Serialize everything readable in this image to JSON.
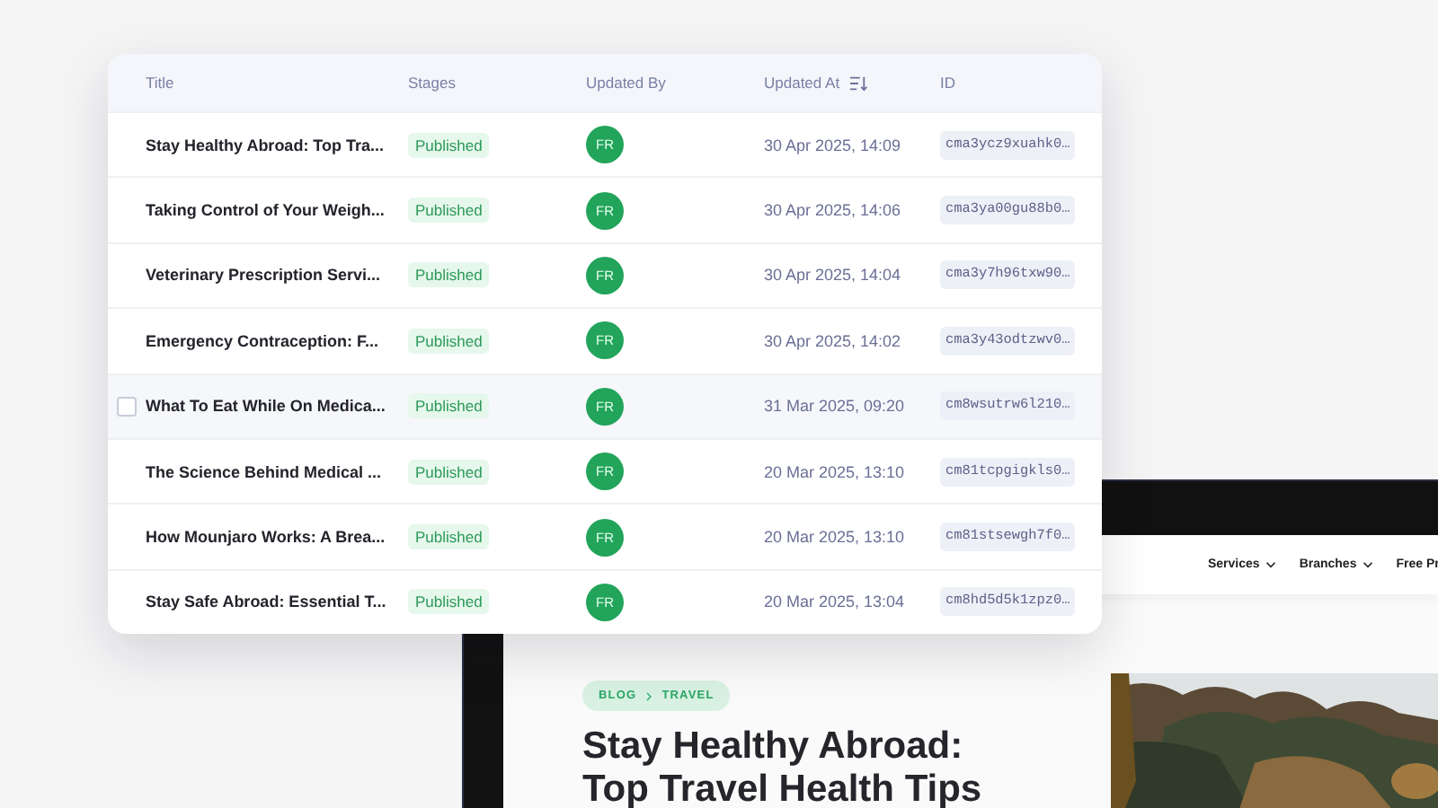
{
  "table": {
    "columns": [
      {
        "label": "Title",
        "sorted": false
      },
      {
        "label": "Stages",
        "sorted": false
      },
      {
        "label": "Updated By",
        "sorted": false
      },
      {
        "label": "Updated At",
        "sorted": true
      },
      {
        "label": "ID",
        "sorted": false
      }
    ],
    "rows": [
      {
        "title": "Stay Healthy Abroad: Top Tra...",
        "stage": "Published",
        "user": "FR",
        "updated": "30 Apr 2025, 14:09",
        "id": "cma3ycz9xuahk0…",
        "highlighted": false
      },
      {
        "title": "Taking Control of Your Weigh...",
        "stage": "Published",
        "user": "FR",
        "updated": "30 Apr 2025, 14:06",
        "id": "cma3ya00gu88b0…",
        "highlighted": false
      },
      {
        "title": "Veterinary Prescription Servi...",
        "stage": "Published",
        "user": "FR",
        "updated": "30 Apr 2025, 14:04",
        "id": "cma3y7h96txw90…",
        "highlighted": false
      },
      {
        "title": "Emergency Contraception: F...",
        "stage": "Published",
        "user": "FR",
        "updated": "30 Apr 2025, 14:02",
        "id": "cma3y43odtzwv0…",
        "highlighted": false
      },
      {
        "title": "What To Eat While On Medica...",
        "stage": "Published",
        "user": "FR",
        "updated": "31 Mar 2025, 09:20",
        "id": "cm8wsutrw6l210…",
        "highlighted": true
      },
      {
        "title": "The Science Behind Medical ...",
        "stage": "Published",
        "user": "FR",
        "updated": "20 Mar 2025, 13:10",
        "id": "cm81tcpgigkls0…",
        "highlighted": false
      },
      {
        "title": "How Mounjaro Works: A Brea...",
        "stage": "Published",
        "user": "FR",
        "updated": "20 Mar 2025, 13:10",
        "id": "cm81stsewgh7f0…",
        "highlighted": false
      },
      {
        "title": "Stay Safe Abroad: Essential T...",
        "stage": "Published",
        "user": "FR",
        "updated": "20 Mar 2025, 13:04",
        "id": "cm8hd5d5k1zpz0…",
        "highlighted": false
      }
    ]
  },
  "website": {
    "nav": [
      {
        "label": "Services",
        "dropdown": true
      },
      {
        "label": "Branches",
        "dropdown": true
      },
      {
        "label": "Free Pr",
        "dropdown": false
      }
    ],
    "breadcrumb": [
      "BLOG",
      "TRAVEL"
    ],
    "heading": "Stay Healthy Abroad: Top Travel Health Tips",
    "image": {
      "kind": "picture"
    }
  }
}
